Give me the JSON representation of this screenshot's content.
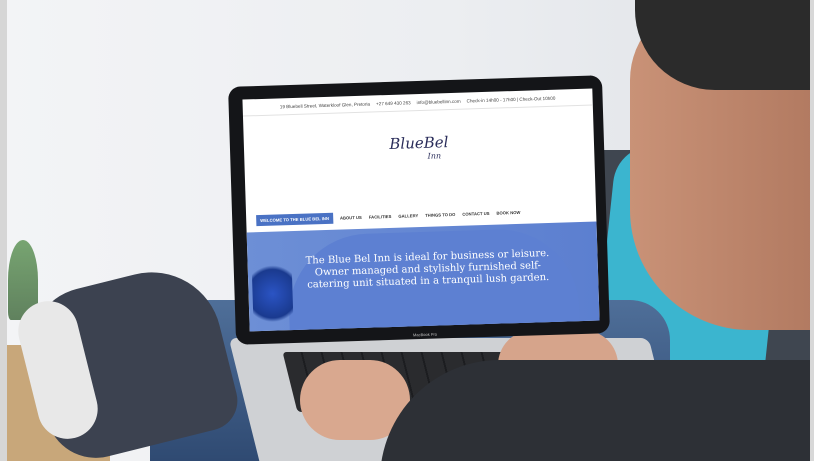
{
  "topbar": {
    "address": "19 Bluebell Street, Waterkloof Glen, Pretoria",
    "phone": "+27 649 430 263",
    "email": "info@bluebellinn.com",
    "hours": "Check-in 14h00 - 17h00 | Check-Out 10h00"
  },
  "logo": {
    "main": "BlueBel",
    "sub": "Inn"
  },
  "nav": {
    "items": [
      "WELCOME TO THE BLUE BEL INN",
      "ABOUT US",
      "FACILITIES",
      "GALLERY",
      "THINGS TO DO",
      "CONTACT US",
      "BOOK NOW"
    ]
  },
  "hero": {
    "text": "The Blue Bel Inn is ideal for business or leisure. Owner managed and stylishly furnished self-catering unit situated in a tranquil lush garden."
  },
  "laptop": {
    "brand": "MacBook Pro"
  },
  "colors": {
    "accent": "#4a72c4",
    "hero": "#5d80d2",
    "pillow": "#3bb5cf"
  }
}
